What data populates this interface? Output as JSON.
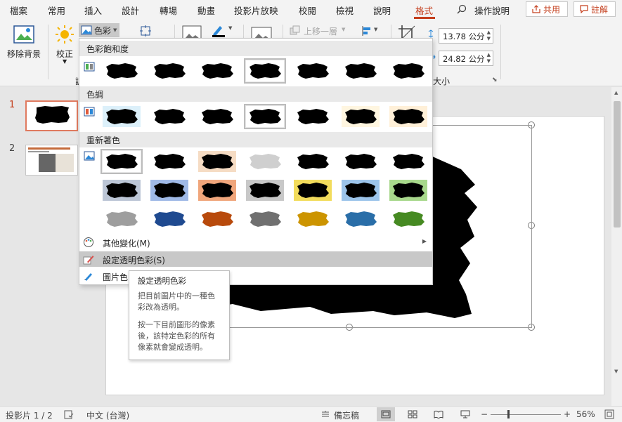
{
  "tabs": [
    "檔案",
    "常用",
    "插入",
    "設計",
    "轉場",
    "動畫",
    "投影片放映",
    "校閱",
    "檢視",
    "說明",
    "格式"
  ],
  "active_tab": "格式",
  "tell_me": "操作說明",
  "share_label": "共用",
  "comments_label": "註解",
  "ribbon": {
    "remove_bg": "移除背景",
    "corrections": "校正",
    "color": "色彩",
    "bring_forward": "上移一層",
    "height": "13.78 公分",
    "width": "24.82 公分",
    "size_group": "大小",
    "adjust_group_partial": "調"
  },
  "dropdown": {
    "saturation_header": "色彩飽和度",
    "tone_header": "色調",
    "recolor_header": "重新著色",
    "more_variations": "其他變化(M)",
    "set_transparent": "設定透明色彩(S)",
    "picture_color_options": "圖片色"
  },
  "tone_tints": [
    "#dcf0fa",
    "#ffffff",
    "#ffffff",
    "#ffffff",
    "#ffffff",
    "#fff6e0",
    "#fff0d8"
  ],
  "recolor_rows": [
    [
      {
        "bg": "#ffffff",
        "fg": "#000000"
      },
      {
        "bg": "#ffffff",
        "fg": "#000000"
      },
      {
        "bg": "#f6dcc4",
        "fg": "#000000"
      },
      {
        "bg": "#ffffff",
        "fg": "#cfcfcf"
      },
      {
        "bg": "#ffffff",
        "fg": "#000000"
      },
      {
        "bg": "#ffffff",
        "fg": "#000000"
      },
      {
        "bg": "#ffffff",
        "fg": "#000000"
      }
    ],
    [
      {
        "bg": "#bcc6d6",
        "fg": "#000000"
      },
      {
        "bg": "#9fb9e6",
        "fg": "#000000"
      },
      {
        "bg": "#f0a67c",
        "fg": "#000000"
      },
      {
        "bg": "#c8c8c8",
        "fg": "#000000"
      },
      {
        "bg": "#f2dc5c",
        "fg": "#000000"
      },
      {
        "bg": "#9cc4ea",
        "fg": "#000000"
      },
      {
        "bg": "#a8d88c",
        "fg": "#000000"
      }
    ],
    [
      {
        "bg": "#ffffff",
        "fg": "#9e9e9e"
      },
      {
        "bg": "#ffffff",
        "fg": "#1f4a90"
      },
      {
        "bg": "#ffffff",
        "fg": "#b84a0c"
      },
      {
        "bg": "#ffffff",
        "fg": "#707070"
      },
      {
        "bg": "#ffffff",
        "fg": "#cc9400"
      },
      {
        "bg": "#ffffff",
        "fg": "#2a6ea8"
      },
      {
        "bg": "#ffffff",
        "fg": "#468a22"
      }
    ]
  ],
  "tooltip": {
    "title": "設定透明色彩",
    "desc1": "把目前圖片中的一種色彩改為透明。",
    "desc2": "按一下目前圖形的像素後，該特定色彩的所有像素就會變成透明。"
  },
  "slides": [
    {
      "num": "1"
    },
    {
      "num": "2"
    }
  ],
  "status": {
    "slide_info": "投影片 1 / 2",
    "language": "中文 (台灣)",
    "notes": "備忘稿",
    "zoom": "56%"
  },
  "colors": {
    "accent": "#c43e1c",
    "slide_border": "#e07a5f"
  }
}
